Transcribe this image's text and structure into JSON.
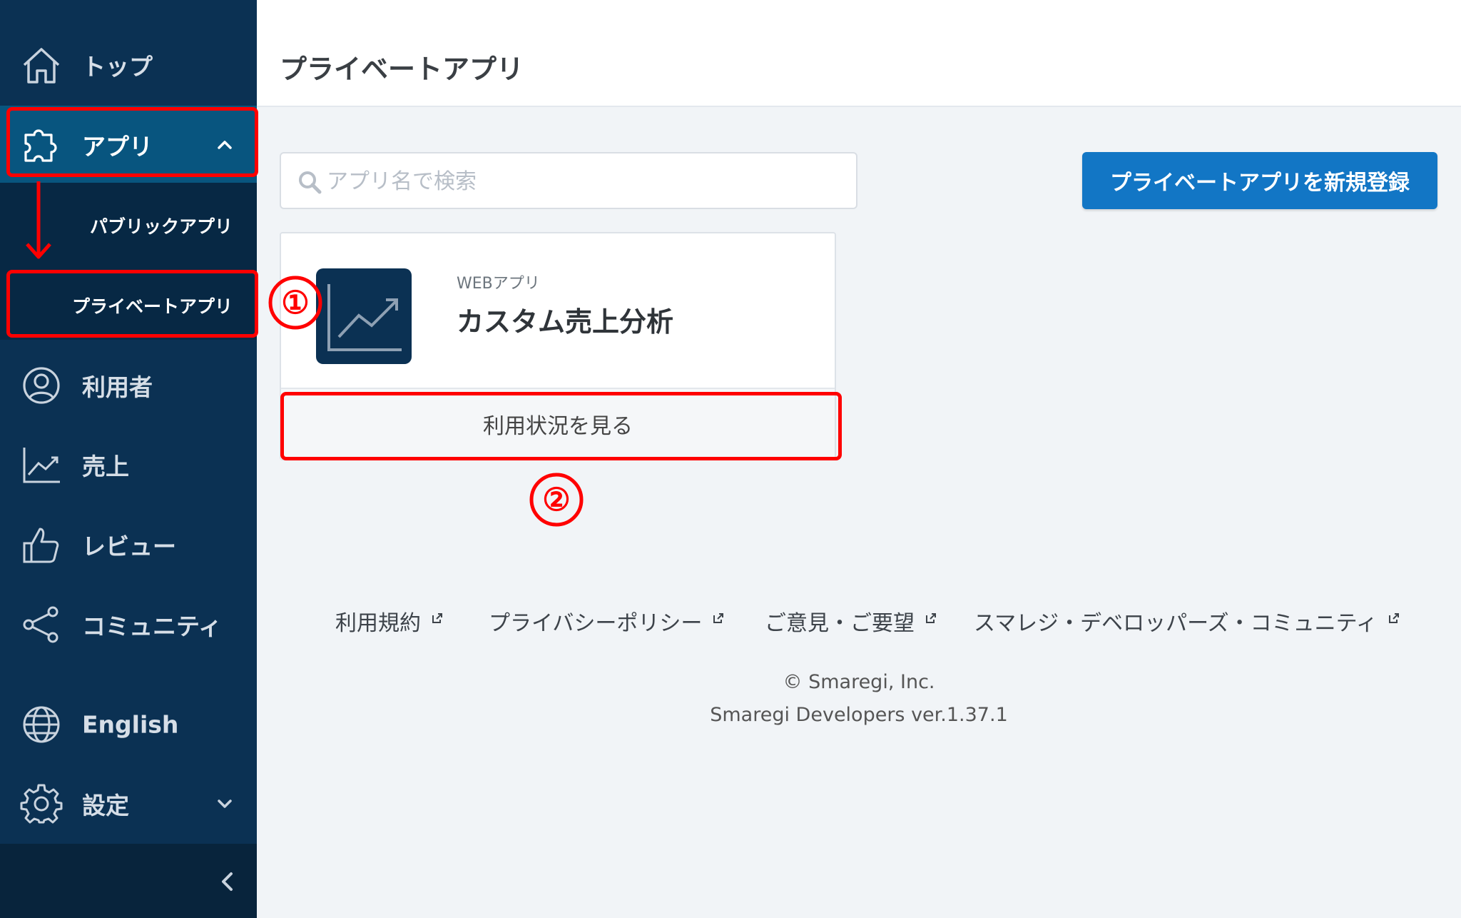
{
  "sidebar": {
    "items": [
      {
        "label": "トップ",
        "icon": "home-icon"
      },
      {
        "label": "アプリ",
        "icon": "puzzle-icon"
      },
      {
        "label": "利用者",
        "icon": "user-icon"
      },
      {
        "label": "売上",
        "icon": "chart-line-icon"
      },
      {
        "label": "レビュー",
        "icon": "thumbs-up-icon"
      },
      {
        "label": "コミュニティ",
        "icon": "share-icon"
      },
      {
        "label": "English",
        "icon": "globe-icon"
      },
      {
        "label": "設定",
        "icon": "gear-icon"
      }
    ],
    "subitems": [
      {
        "label": "パブリックアプリ"
      },
      {
        "label": "プライベートアプリ"
      }
    ]
  },
  "header": {
    "title": "プライベートアプリ"
  },
  "search": {
    "placeholder": "アプリ名で検索"
  },
  "new_button": {
    "label": "プライベートアプリを新規登録"
  },
  "app_card": {
    "type": "WEBアプリ",
    "name": "カスタム売上分析",
    "action": "利用状況を見る"
  },
  "footer": {
    "links": [
      {
        "label": "利用規約"
      },
      {
        "label": "プライバシーポリシー"
      },
      {
        "label": "ご意見・ご要望"
      },
      {
        "label": "スマレジ・デベロッパーズ・コミュニティ"
      }
    ],
    "copyright": "© Smaregi, Inc.",
    "version": "Smaregi Developers ver.1.37.1"
  },
  "annotations": {
    "step1": "①",
    "step2": "②"
  },
  "colors": {
    "sidebar": "#0b3153",
    "sidebar_active": "#08557f",
    "primary_button": "#1276c5",
    "annotation": "#ff0000"
  }
}
